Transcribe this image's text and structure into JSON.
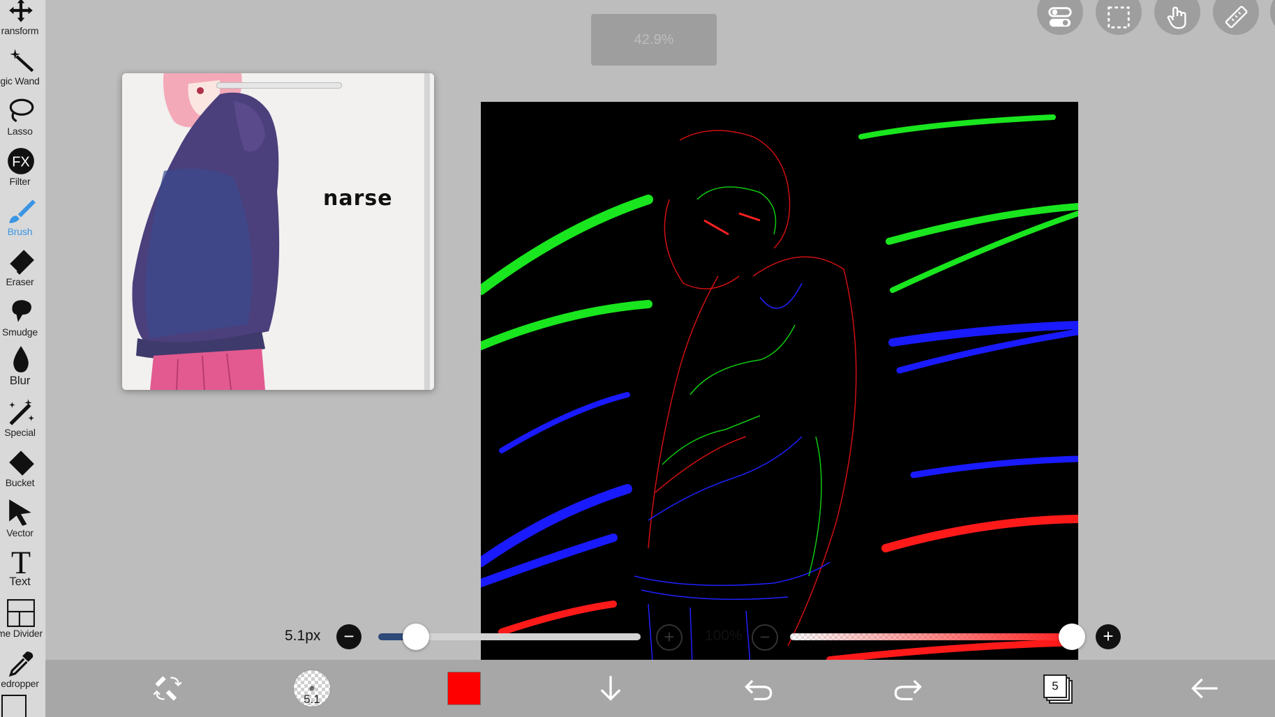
{
  "toolbar": {
    "tools": [
      {
        "label": "ransform",
        "icon": "transform-icon"
      },
      {
        "label": "gic Wand",
        "icon": "magic-wand-icon"
      },
      {
        "label": "Lasso",
        "icon": "lasso-icon"
      },
      {
        "label": "Filter",
        "icon": "fx-icon"
      },
      {
        "label": "Brush",
        "icon": "brush-icon"
      },
      {
        "label": "Eraser",
        "icon": "eraser-icon"
      },
      {
        "label": "Smudge",
        "icon": "smudge-icon"
      },
      {
        "label": "Blur",
        "icon": "blur-drop-icon"
      },
      {
        "label": "Special",
        "icon": "special-icon"
      },
      {
        "label": "Bucket",
        "icon": "bucket-icon"
      },
      {
        "label": "Vector",
        "icon": "vector-icon"
      },
      {
        "label": "Text",
        "icon": "text-icon"
      },
      {
        "label": "me Divider",
        "icon": "frame-divider-icon"
      },
      {
        "label": "edropper",
        "icon": "eyedropper-icon"
      }
    ],
    "active_tool": "Brush",
    "active_color": "#3a95e3"
  },
  "zoom_indicator": "42.9%",
  "fx_label": "FX",
  "text_tool_glyph": "T",
  "reference": {
    "logo_text": "narse"
  },
  "brush_controls": {
    "size_label": "5.1px",
    "size_value": 5.1,
    "minus": "−",
    "plus": "+",
    "opacity_label": "100%",
    "opacity_value": 1.0
  },
  "bottom_bar": {
    "brush_size_badge": "5.1",
    "color": "#ff0000",
    "layer_count": "5"
  },
  "colors": {
    "background": "#bdbdbd",
    "toolbar": "#d9d9d9",
    "bottom_bar": "#a7a7a7"
  }
}
